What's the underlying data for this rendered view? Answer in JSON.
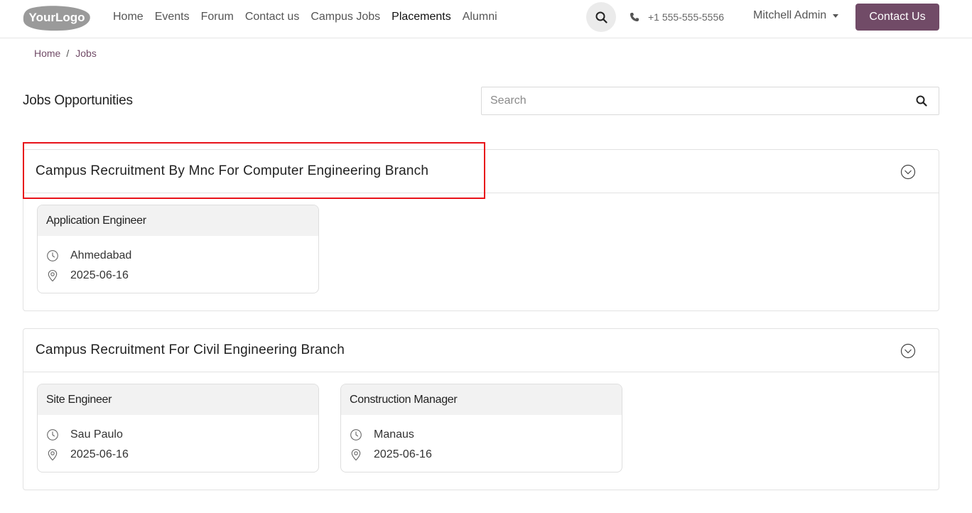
{
  "header": {
    "logo_text": "YourLogo",
    "nav": [
      "Home",
      "Events",
      "Forum",
      "Contact us",
      "Campus Jobs",
      "Placements",
      "Alumni"
    ],
    "active_nav": "Placements",
    "phone": "+1 555-555-5556",
    "user": "Mitchell Admin",
    "contact_button": "Contact Us"
  },
  "breadcrumb": {
    "home": "Home",
    "current": "Jobs"
  },
  "page": {
    "title": "Jobs Opportunities",
    "search_placeholder": "Search"
  },
  "groups": [
    {
      "title": "Campus Recruitment By Mnc For Computer Engineering Branch",
      "jobs": [
        {
          "title": "Application Engineer",
          "location": "Ahmedabad",
          "date": "2025-06-16"
        }
      ]
    },
    {
      "title": "Campus Recruitment For Civil Engineering Branch",
      "jobs": [
        {
          "title": "Site Engineer",
          "location": "Sau Paulo",
          "date": "2025-06-16"
        },
        {
          "title": "Construction Manager",
          "location": "Manaus",
          "date": "2025-06-16"
        }
      ]
    }
  ],
  "colors": {
    "brand": "#714b67",
    "highlight": "#e8121a"
  },
  "icons": {
    "search": "search-icon",
    "phone": "phone-icon",
    "clock": "clock-icon",
    "location": "location-pin-icon",
    "expand": "chevron-down-circle-icon"
  }
}
